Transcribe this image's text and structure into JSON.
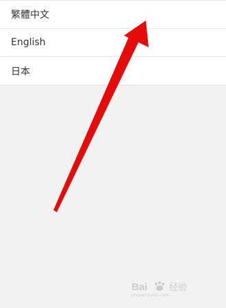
{
  "language_menu": {
    "items": [
      {
        "label": "繁體中文"
      },
      {
        "label": "English"
      },
      {
        "label": "日本"
      }
    ]
  },
  "annotation": {
    "arrow_color": "#e60b0b"
  },
  "watermark": {
    "brand_text": "Bai 经验",
    "sub_text": "jingyan.baidu.com",
    "color": "#b0b0b0"
  }
}
